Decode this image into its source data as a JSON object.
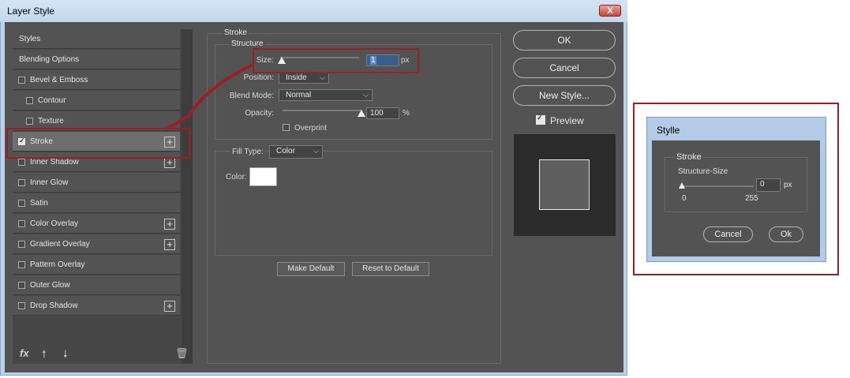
{
  "main_window": {
    "title": "Layer Style",
    "close_label": "X"
  },
  "style_list": {
    "items": [
      {
        "label": "Styles",
        "checkbox": false,
        "checked": false,
        "plus": false,
        "indent": false,
        "selected": false
      },
      {
        "label": "Blending Options",
        "checkbox": false,
        "checked": false,
        "plus": false,
        "indent": false,
        "selected": false
      },
      {
        "label": "Bevel & Emboss",
        "checkbox": true,
        "checked": false,
        "plus": false,
        "indent": false,
        "selected": false
      },
      {
        "label": "Contour",
        "checkbox": true,
        "checked": false,
        "plus": false,
        "indent": true,
        "selected": false
      },
      {
        "label": "Texture",
        "checkbox": true,
        "checked": false,
        "plus": false,
        "indent": true,
        "selected": false
      },
      {
        "label": "Stroke",
        "checkbox": true,
        "checked": true,
        "plus": true,
        "indent": false,
        "selected": true
      },
      {
        "label": "Inner Shadow",
        "checkbox": true,
        "checked": false,
        "plus": true,
        "indent": false,
        "selected": false
      },
      {
        "label": "Inner Glow",
        "checkbox": true,
        "checked": false,
        "plus": false,
        "indent": false,
        "selected": false
      },
      {
        "label": "Satin",
        "checkbox": true,
        "checked": false,
        "plus": false,
        "indent": false,
        "selected": false
      },
      {
        "label": "Color Overlay",
        "checkbox": true,
        "checked": false,
        "plus": true,
        "indent": false,
        "selected": false
      },
      {
        "label": "Gradient Overlay",
        "checkbox": true,
        "checked": false,
        "plus": true,
        "indent": false,
        "selected": false
      },
      {
        "label": "Pattern Overlay",
        "checkbox": true,
        "checked": false,
        "plus": false,
        "indent": false,
        "selected": false
      },
      {
        "label": "Outer Glow",
        "checkbox": true,
        "checked": false,
        "plus": false,
        "indent": false,
        "selected": false
      },
      {
        "label": "Drop Shadow",
        "checkbox": true,
        "checked": false,
        "plus": true,
        "indent": false,
        "selected": false
      }
    ],
    "footer": {
      "fx_label": "fx",
      "fx_icon": "fx-icon",
      "up_icon": "arrow-up-icon",
      "down_icon": "arrow-down-icon",
      "trash_icon": "trash-icon"
    }
  },
  "stroke_panel": {
    "group_title": "Stroke",
    "structure_title": "Structure",
    "size": {
      "label": "Size:",
      "value": "1",
      "unit": "px",
      "slider_fraction": 0.0
    },
    "position": {
      "label": "Position:",
      "value": "Inside"
    },
    "blend_mode": {
      "label": "Blend Mode:",
      "value": "Normal"
    },
    "opacity": {
      "label": "Opacity:",
      "value": "100",
      "unit": "%",
      "slider_fraction": 1.0
    },
    "overprint": {
      "label": "Overprint",
      "checked": false
    },
    "fill_type": {
      "label": "Fill Type:",
      "value": "Color"
    },
    "color": {
      "label": "Color:",
      "swatch": "#ffffff"
    },
    "make_default": "Make Default",
    "reset_default": "Reset to Default"
  },
  "right_panel": {
    "ok": "OK",
    "cancel": "Cancel",
    "new_style": "New Style...",
    "preview_label": "Preview",
    "preview_checked": true
  },
  "small_dialog": {
    "title": "Stylle",
    "group_title": "Stroke",
    "field_label": "Structure-Size",
    "value": "0",
    "unit": "px",
    "min_label": "0",
    "max_label": "255",
    "slider_fraction": 0.0,
    "cancel": "Cancel",
    "ok": "Ok"
  },
  "colors": {
    "panel_bg": "#535353",
    "highlight_red": "#9c1f24",
    "window_frame": "#b9d1ea"
  }
}
